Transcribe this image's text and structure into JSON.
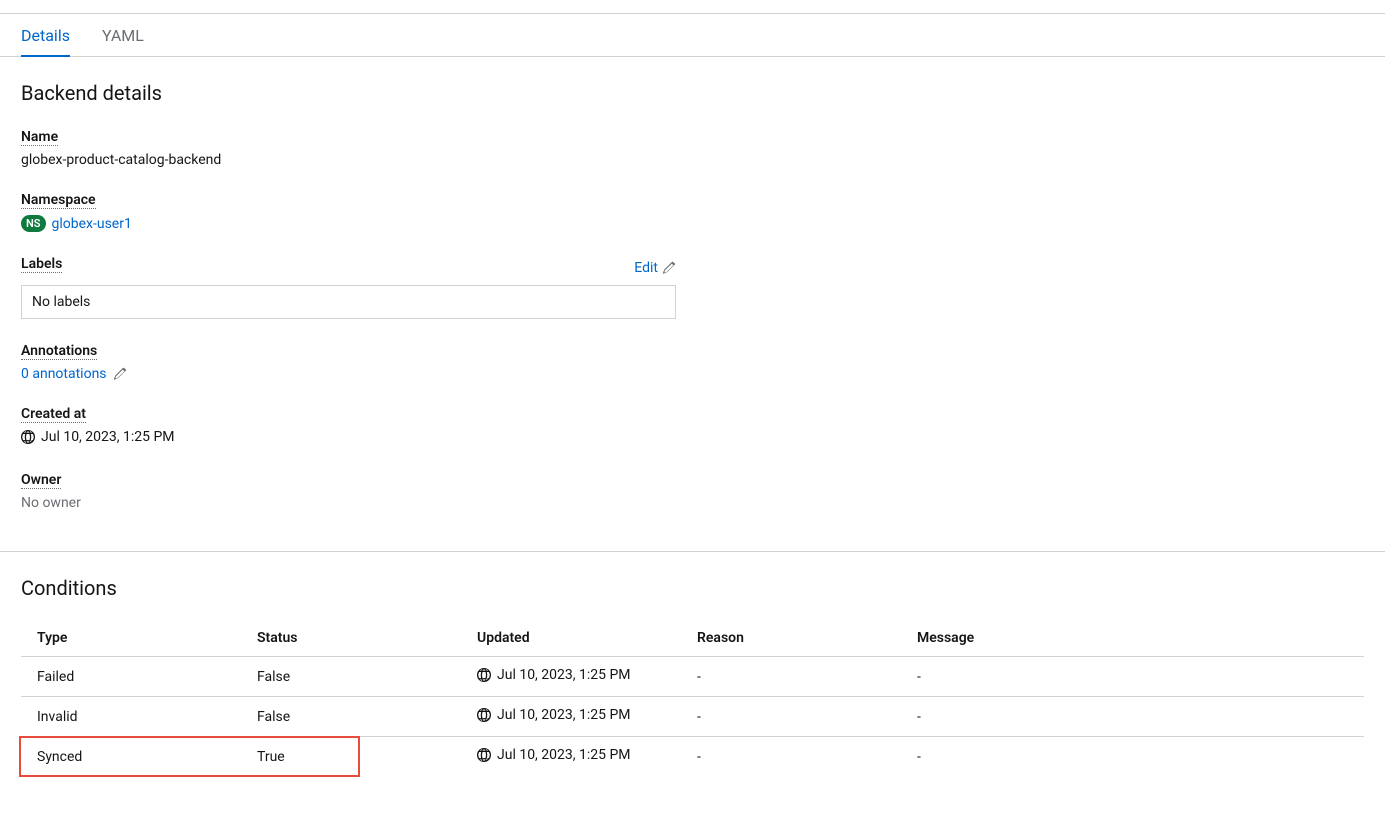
{
  "tabs": [
    {
      "label": "Details",
      "active": true
    },
    {
      "label": "YAML",
      "active": false
    }
  ],
  "section_title": "Backend details",
  "fields": {
    "name": {
      "label": "Name",
      "value": "globex-product-catalog-backend"
    },
    "namespace": {
      "label": "Namespace",
      "badge": "NS",
      "value": "globex-user1"
    },
    "labels": {
      "label": "Labels",
      "edit": "Edit",
      "value": "No labels"
    },
    "annotations": {
      "label": "Annotations",
      "value": "0 annotations"
    },
    "created": {
      "label": "Created at",
      "value": "Jul 10, 2023, 1:25 PM"
    },
    "owner": {
      "label": "Owner",
      "value": "No owner"
    }
  },
  "conditions": {
    "title": "Conditions",
    "headers": [
      "Type",
      "Status",
      "Updated",
      "Reason",
      "Message"
    ],
    "rows": [
      {
        "type": "Failed",
        "status": "False",
        "updated": "Jul 10, 2023, 1:25 PM",
        "reason": "-",
        "message": "-"
      },
      {
        "type": "Invalid",
        "status": "False",
        "updated": "Jul 10, 2023, 1:25 PM",
        "reason": "-",
        "message": "-"
      },
      {
        "type": "Synced",
        "status": "True",
        "updated": "Jul 10, 2023, 1:25 PM",
        "reason": "-",
        "message": "-"
      }
    ],
    "highlighted_row_index": 2
  }
}
